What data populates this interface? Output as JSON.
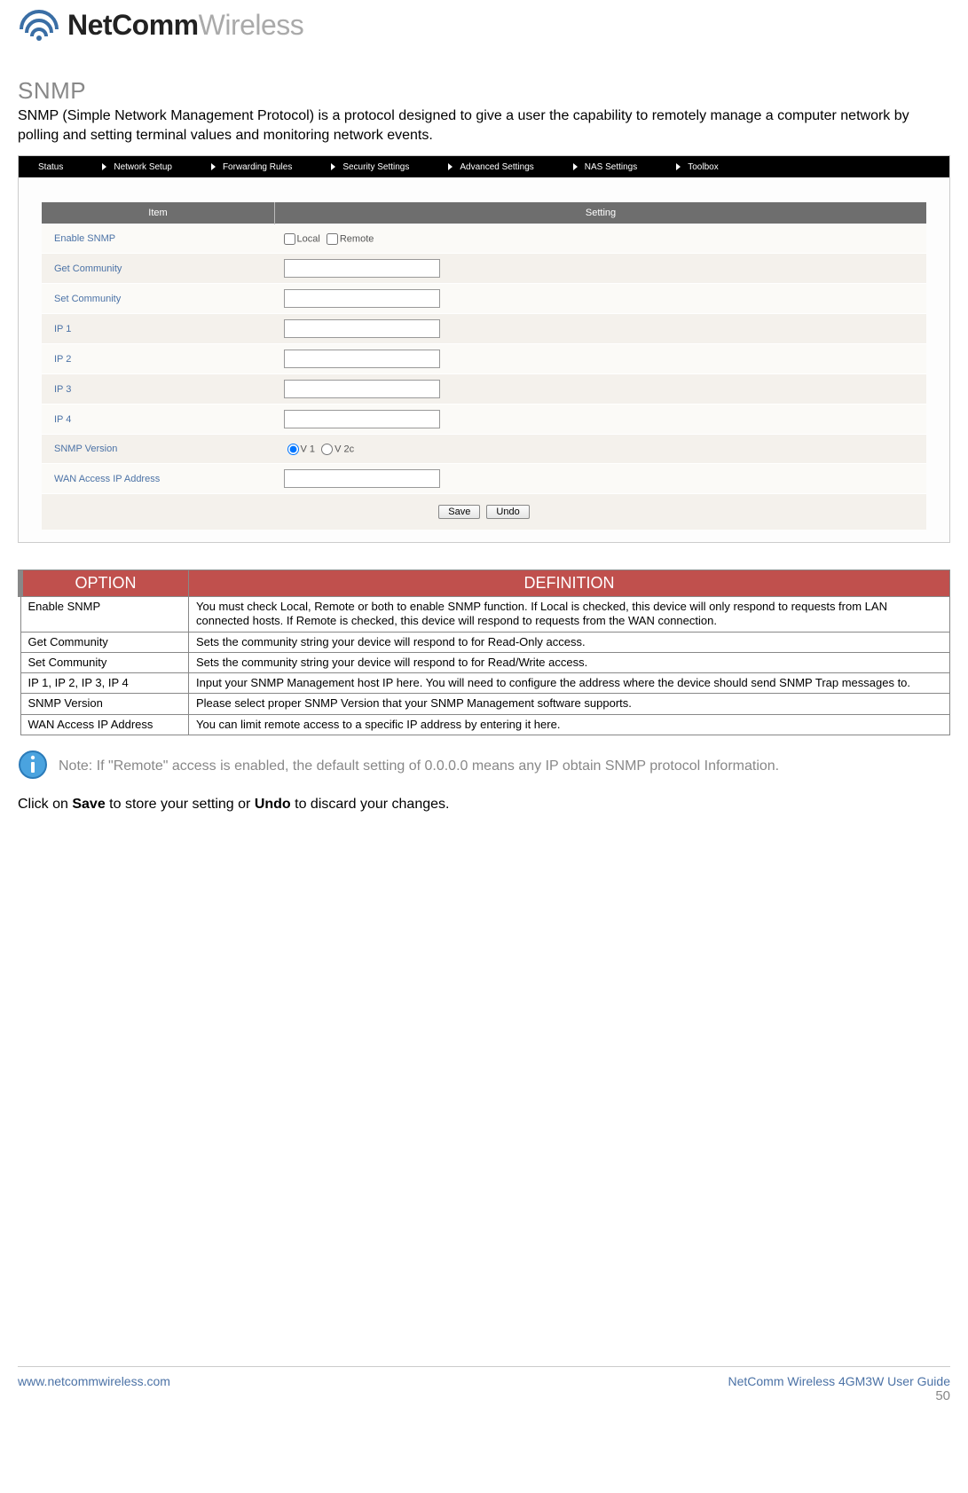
{
  "brand": {
    "part1": "NetComm",
    "part2": "Wireless"
  },
  "section": {
    "title": "SNMP",
    "intro": "SNMP (Simple Network Management Protocol) is a protocol designed to give a user the capability to remotely manage a computer network by polling and setting terminal values and monitoring network events."
  },
  "nav": {
    "items": [
      "Status",
      "Network Setup",
      "Forwarding Rules",
      "Security Settings",
      "Advanced Settings",
      "NAS Settings",
      "Toolbox"
    ]
  },
  "form": {
    "head_item": "Item",
    "head_setting": "Setting",
    "rows": {
      "enable": "Enable SNMP",
      "enable_opt1": "Local",
      "enable_opt2": "Remote",
      "get": "Get Community",
      "set": "Set Community",
      "ip1": "IP 1",
      "ip2": "IP 2",
      "ip3": "IP 3",
      "ip4": "IP 4",
      "ver": "SNMP Version",
      "ver_opt1": "V 1",
      "ver_opt2": "V 2c",
      "wan": "WAN Access IP Address"
    },
    "save": "Save",
    "undo": "Undo"
  },
  "definitions": {
    "head_option": "OPTION",
    "head_def": "DEFINITION",
    "rows": [
      {
        "o": "Enable SNMP",
        "d": "You must check Local, Remote or both to enable SNMP function. If Local is checked, this device will only respond to requests from LAN connected hosts. If Remote is checked, this device will respond to requests from the WAN connection."
      },
      {
        "o": "Get Community",
        "d": "Sets the community string your device will respond to for Read-Only access."
      },
      {
        "o": "Set Community",
        "d": "Sets the community string your device will respond to for Read/Write access."
      },
      {
        "o": "IP 1, IP 2, IP 3, IP 4",
        "d": "Input your SNMP Management host IP here. You will need to configure the address where the device should send SNMP Trap messages to."
      },
      {
        "o": "SNMP Version",
        "d": "Please select proper SNMP Version that your SNMP Management software supports."
      },
      {
        "o": "WAN Access IP Address",
        "d": "You can limit remote access to a specific IP address by entering it here."
      }
    ]
  },
  "note": "Note: If \"Remote\" access is enabled, the default setting of 0.0.0.0 means any IP obtain SNMP protocol Information.",
  "closing": {
    "pre": "Click on ",
    "save": "Save",
    "mid": " to store your setting or ",
    "undo": "Undo",
    "post": " to discard your changes."
  },
  "footer": {
    "url": "www.netcommwireless.com",
    "guide": "NetComm Wireless 4GM3W User Guide",
    "page": "50"
  }
}
